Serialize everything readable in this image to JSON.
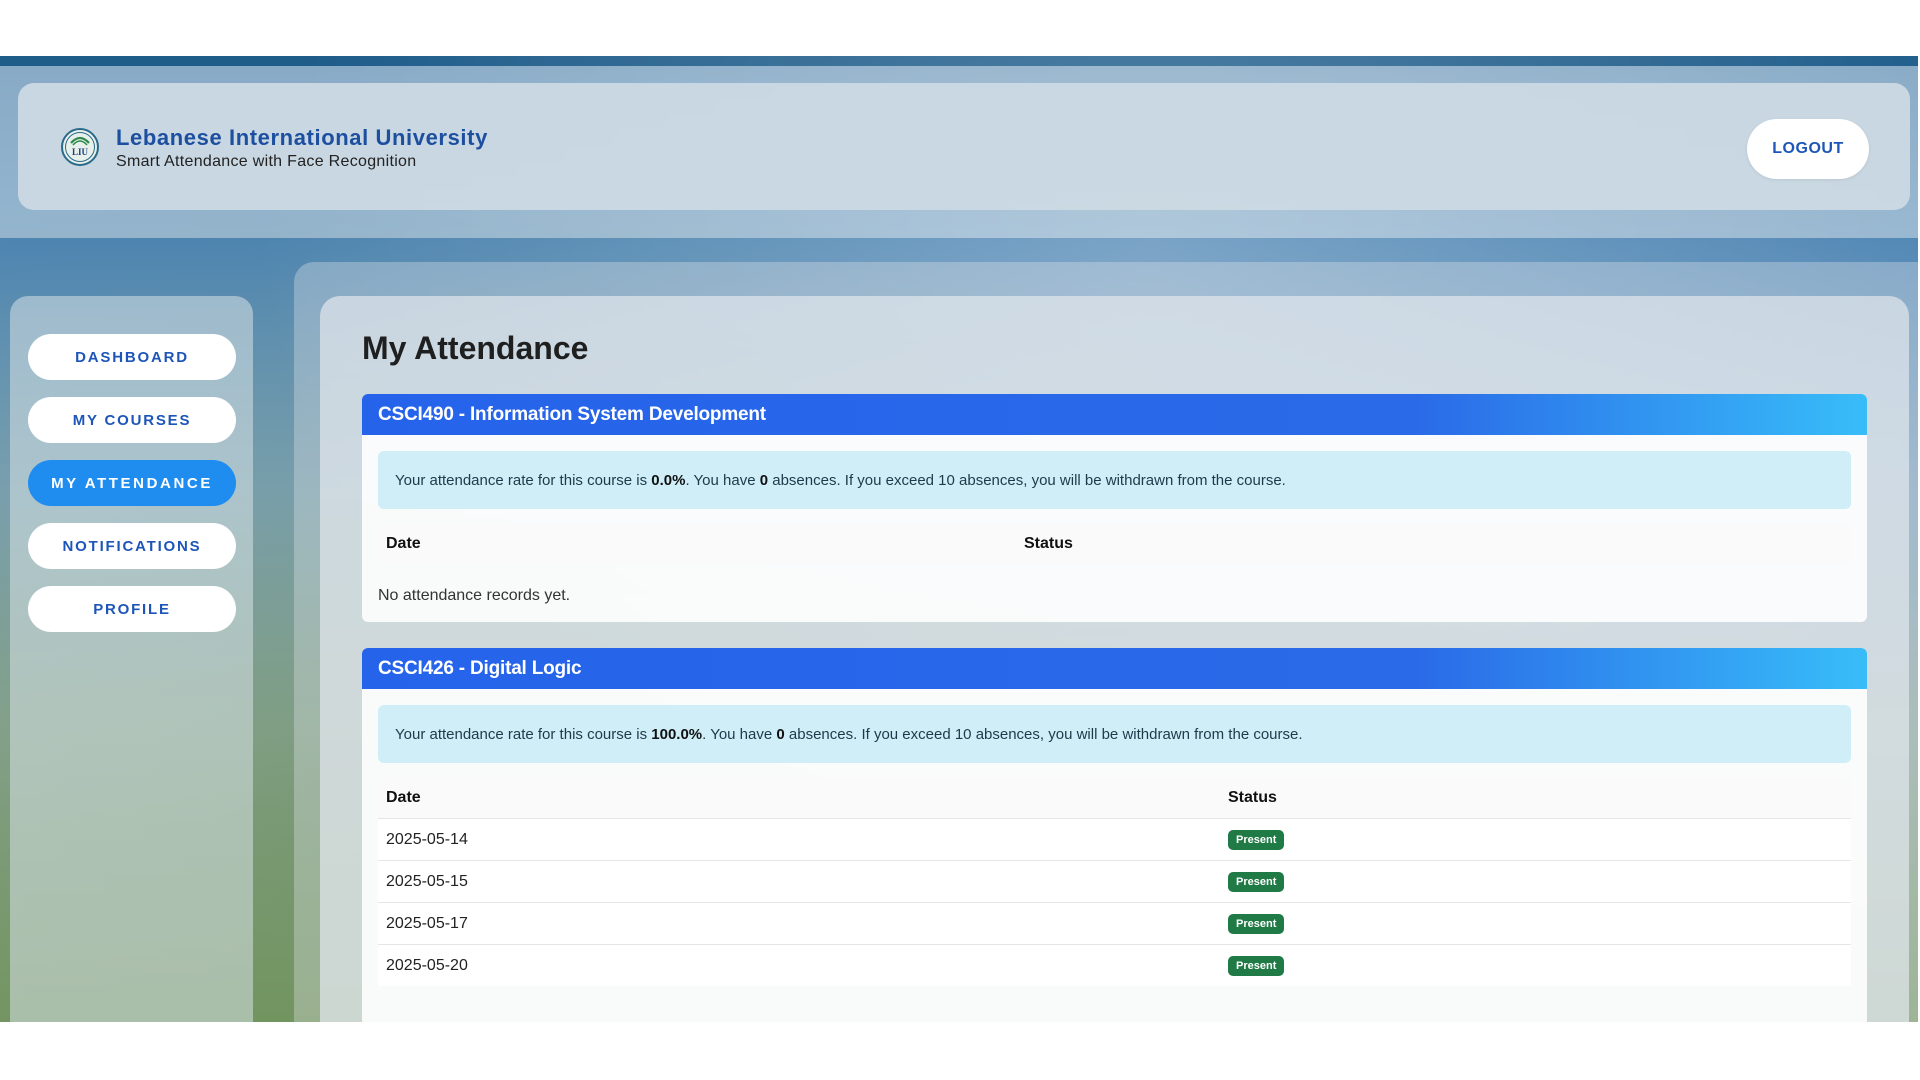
{
  "header": {
    "title": "Lebanese International University",
    "subtitle": "Smart Attendance with Face Recognition",
    "logo_text": "LIU",
    "logout_label": "LOGOUT"
  },
  "sidebar": {
    "items": [
      {
        "label": "DASHBOARD",
        "active": false
      },
      {
        "label": "MY COURSES",
        "active": false
      },
      {
        "label": "MY ATTENDANCE",
        "active": true
      },
      {
        "label": "NOTIFICATIONS",
        "active": false
      },
      {
        "label": "PROFILE",
        "active": false
      }
    ]
  },
  "main": {
    "title": "My Attendance",
    "courses": [
      {
        "header": "CSCI490 - Information System Development",
        "alert": {
          "prefix": "Your attendance rate for this course is ",
          "rate": "0.0%",
          "middle": ". You have ",
          "absences": "0",
          "suffix": " absences. If you exceed 10 absences, you will be withdrawn from the course."
        },
        "columns": [
          "Date",
          "Status"
        ],
        "empty_text": "No attendance records yet.",
        "rows": []
      },
      {
        "header": "CSCI426 - Digital Logic",
        "alert": {
          "prefix": "Your attendance rate for this course is ",
          "rate": "100.0%",
          "middle": ". You have ",
          "absences": "0",
          "suffix": " absences. If you exceed 10 absences, you will be withdrawn from the course."
        },
        "columns": [
          "Date",
          "Status"
        ],
        "rows": [
          {
            "date": "2025-05-14",
            "status": "Present"
          },
          {
            "date": "2025-05-15",
            "status": "Present"
          },
          {
            "date": "2025-05-17",
            "status": "Present"
          },
          {
            "date": "2025-05-20",
            "status": "Present"
          }
        ]
      }
    ]
  },
  "colors": {
    "brand_blue": "#1d56b8",
    "active_nav": "#1f8cf0",
    "card_header_start": "#2563eb",
    "card_header_end": "#38bdf8",
    "alert_bg": "#cfeef8",
    "present_badge": "#1f7a45"
  }
}
